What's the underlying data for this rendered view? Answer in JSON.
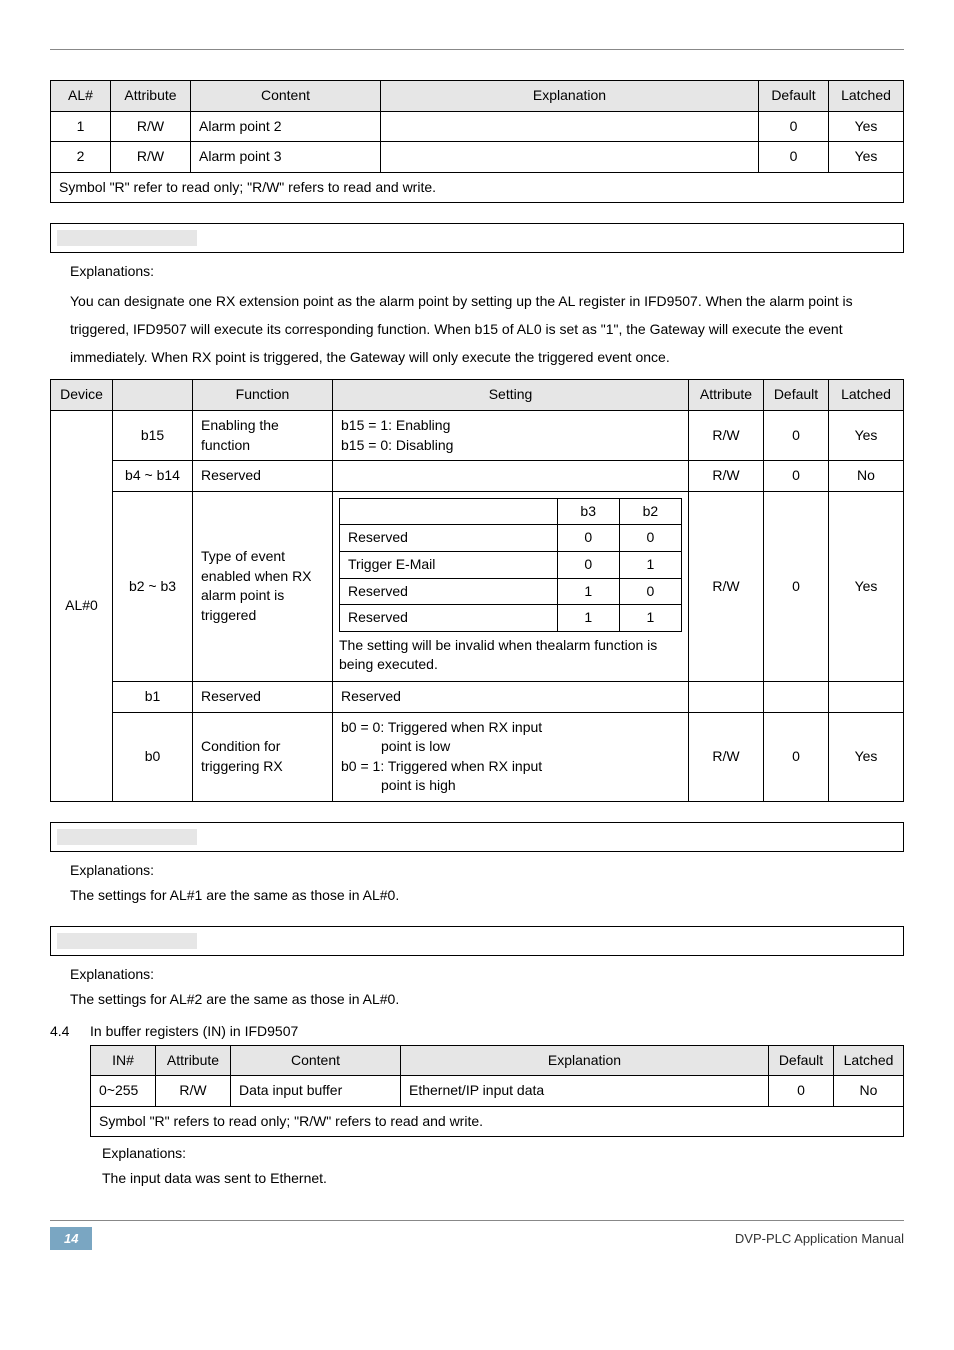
{
  "table1": {
    "headers": [
      "AL#",
      "Attribute",
      "Content",
      "Explanation",
      "Default",
      "Latched"
    ],
    "rows": [
      [
        "1",
        "R/W",
        "Alarm point 2",
        "",
        "0",
        "Yes"
      ],
      [
        "2",
        "R/W",
        "Alarm point 3",
        "",
        "0",
        "Yes"
      ]
    ],
    "footnote": "Symbol \"R\" refer to read only; \"R/W\" refers to read and write."
  },
  "explanations_label": "Explanations:",
  "para1": "You can designate one RX extension point as the alarm point by setting up the AL register in IFD9507. When the alarm point is triggered, IFD9507 will execute its corresponding function. When b15 of AL0 is set as \"1\", the Gateway will execute the event immediately. When RX point is triggered, the Gateway will only execute the triggered event once.",
  "device_table": {
    "headers": [
      "Device",
      "",
      "Function",
      "Setting",
      "Attribute",
      "Default",
      "Latched"
    ],
    "device": "AL#0",
    "rows": {
      "b15": {
        "bits": "b15",
        "function": "Enabling the function",
        "setting_l1": "b15 = 1: Enabling",
        "setting_l2": "b15 = 0: Disabling",
        "attr": "R/W",
        "def": "0",
        "lat": "Yes"
      },
      "b4b14": {
        "bits": "b4 ~ b14",
        "function": "Reserved",
        "setting": "",
        "attr": "R/W",
        "def": "0",
        "lat": "No"
      },
      "b2b3": {
        "bits": "b2 ~ b3",
        "function": "Type of event enabled when RX alarm point is triggered",
        "sub_headers": [
          "",
          "b3",
          "b2"
        ],
        "sub_rows": [
          [
            "Reserved",
            "0",
            "0"
          ],
          [
            "Trigger E-Mail",
            "0",
            "1"
          ],
          [
            "Reserved",
            "1",
            "0"
          ],
          [
            "Reserved",
            "1",
            "1"
          ]
        ],
        "note": "The setting will be invalid when thealarm function is being executed.",
        "attr": "R/W",
        "def": "0",
        "lat": "Yes"
      },
      "b1": {
        "bits": "b1",
        "function": "Reserved",
        "setting": "Reserved",
        "attr": "",
        "def": "",
        "lat": ""
      },
      "b0": {
        "bits": "b0",
        "function": "Condition for triggering RX",
        "setting_l1": "b0 = 0: Triggered when RX input",
        "setting_l2": "point is low",
        "setting_l3": "b0 = 1: Triggered when RX input",
        "setting_l4": "point is high",
        "attr": "R/W",
        "def": "0",
        "lat": "Yes"
      }
    }
  },
  "para_al1": "The settings for AL#1 are the same as those in AL#0.",
  "para_al2": "The settings for AL#2 are the same as those in AL#0.",
  "section44": {
    "num": "4.4",
    "title": "In buffer registers (IN) in IFD9507"
  },
  "table_in": {
    "headers": [
      "IN#",
      "Attribute",
      "Content",
      "Explanation",
      "Default",
      "Latched"
    ],
    "row": [
      "0~255",
      "R/W",
      "Data input buffer",
      "Ethernet/IP input data",
      "0",
      "No"
    ],
    "footnote": "Symbol \"R\" refers to read only; \"R/W\" refers to read and write."
  },
  "para_in": "The input data was sent to Ethernet.",
  "footer": {
    "page": "14",
    "manual": "DVP-PLC  Application  Manual"
  }
}
